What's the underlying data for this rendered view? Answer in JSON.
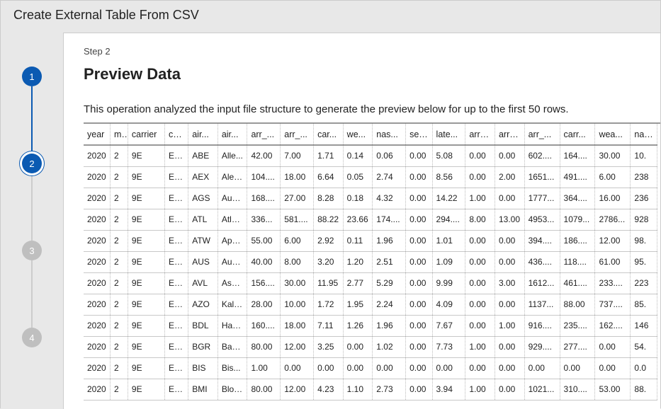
{
  "window": {
    "title": "Create External Table From CSV"
  },
  "stepper": {
    "steps": [
      "1",
      "2",
      "3",
      "4"
    ],
    "current_index": 1
  },
  "content": {
    "step_label": "Step 2",
    "heading": "Preview Data",
    "description": "This operation analyzed the input file structure to generate the preview below for up to the first 50 rows."
  },
  "table": {
    "columns": [
      "year",
      "m...",
      "carrier",
      "ca...",
      "air...",
      "air...",
      "arr_...",
      "arr_...",
      "car...",
      "we...",
      "nas...",
      "sec...",
      "late...",
      "arr_...",
      "arr_...",
      "arr_...",
      "carr...",
      "wea...",
      "nas..."
    ],
    "rows": [
      [
        "2020",
        "2",
        "9E",
        "En...",
        "ABE",
        "Alle...",
        "42.00",
        "7.00",
        "1.71",
        "0.14",
        "0.06",
        "0.00",
        "5.08",
        "0.00",
        "0.00",
        "602....",
        "164....",
        "30.00",
        "10."
      ],
      [
        "2020",
        "2",
        "9E",
        "En...",
        "AEX",
        "Alex...",
        "104....",
        "18.00",
        "6.64",
        "0.05",
        "2.74",
        "0.00",
        "8.56",
        "0.00",
        "2.00",
        "1651...",
        "491....",
        "6.00",
        "238"
      ],
      [
        "2020",
        "2",
        "9E",
        "En...",
        "AGS",
        "Aug...",
        "168....",
        "27.00",
        "8.28",
        "0.18",
        "4.32",
        "0.00",
        "14.22",
        "1.00",
        "0.00",
        "1777...",
        "364....",
        "16.00",
        "236"
      ],
      [
        "2020",
        "2",
        "9E",
        "En...",
        "ATL",
        "Atla...",
        "336...",
        "581....",
        "88.22",
        "23.66",
        "174....",
        "0.00",
        "294....",
        "8.00",
        "13.00",
        "4953...",
        "1079...",
        "2786...",
        "928"
      ],
      [
        "2020",
        "2",
        "9E",
        "En...",
        "ATW",
        "App...",
        "55.00",
        "6.00",
        "2.92",
        "0.11",
        "1.96",
        "0.00",
        "1.01",
        "0.00",
        "0.00",
        "394....",
        "186....",
        "12.00",
        "98."
      ],
      [
        "2020",
        "2",
        "9E",
        "En...",
        "AUS",
        "Aust...",
        "40.00",
        "8.00",
        "3.20",
        "1.20",
        "2.51",
        "0.00",
        "1.09",
        "0.00",
        "0.00",
        "436....",
        "118....",
        "61.00",
        "95."
      ],
      [
        "2020",
        "2",
        "9E",
        "En...",
        "AVL",
        "Ash...",
        "156....",
        "30.00",
        "11.95",
        "2.77",
        "5.29",
        "0.00",
        "9.99",
        "0.00",
        "3.00",
        "1612...",
        "461....",
        "233....",
        "223"
      ],
      [
        "2020",
        "2",
        "9E",
        "En...",
        "AZO",
        "Kala...",
        "28.00",
        "10.00",
        "1.72",
        "1.95",
        "2.24",
        "0.00",
        "4.09",
        "0.00",
        "0.00",
        "1137...",
        "88.00",
        "737....",
        "85."
      ],
      [
        "2020",
        "2",
        "9E",
        "En...",
        "BDL",
        "Hart...",
        "160....",
        "18.00",
        "7.11",
        "1.26",
        "1.96",
        "0.00",
        "7.67",
        "0.00",
        "1.00",
        "916....",
        "235....",
        "162....",
        "146"
      ],
      [
        "2020",
        "2",
        "9E",
        "En...",
        "BGR",
        "Ban...",
        "80.00",
        "12.00",
        "3.25",
        "0.00",
        "1.02",
        "0.00",
        "7.73",
        "1.00",
        "0.00",
        "929....",
        "277....",
        "0.00",
        "54."
      ],
      [
        "2020",
        "2",
        "9E",
        "En...",
        "BIS",
        "Bis...",
        "1.00",
        "0.00",
        "0.00",
        "0.00",
        "0.00",
        "0.00",
        "0.00",
        "0.00",
        "0.00",
        "0.00",
        "0.00",
        "0.00",
        "0.0"
      ],
      [
        "2020",
        "2",
        "9E",
        "En...",
        "BMI",
        "Bloo...",
        "80.00",
        "12.00",
        "4.23",
        "1.10",
        "2.73",
        "0.00",
        "3.94",
        "1.00",
        "0.00",
        "1021...",
        "310....",
        "53.00",
        "88."
      ]
    ]
  }
}
